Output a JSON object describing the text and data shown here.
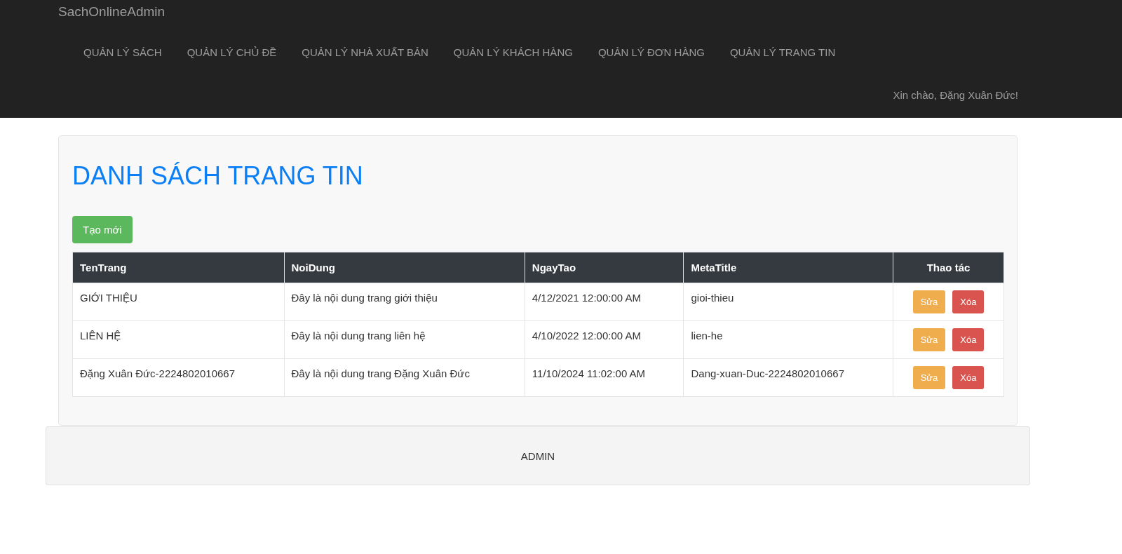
{
  "navbar": {
    "brand": "SachOnlineAdmin",
    "items": [
      "QUẢN LÝ SÁCH",
      "QUẢN LÝ CHỦ ĐỀ",
      "QUẢN LÝ NHÀ XUẤT BẢN",
      "QUẢN LÝ KHÁCH HÀNG",
      "QUẢN LÝ ĐƠN HÀNG",
      "QUẢN LÝ TRANG TIN"
    ],
    "greeting": "Xin chào, Đặng Xuân Đức!"
  },
  "page": {
    "title": "DANH SÁCH TRANG TIN",
    "create_button": "Tạo mới"
  },
  "table": {
    "columns": [
      "TenTrang",
      "NoiDung",
      "NgayTao",
      "MetaTitle",
      "Thao tác"
    ],
    "rows": [
      {
        "cells": [
          "GIỚI THIỆU",
          "Đây là nội dung trang giới thiệu",
          "4/12/2021 12:00:00 AM",
          "gioi-thieu"
        ],
        "actions": [
          "Sửa",
          "Xóa"
        ]
      },
      {
        "cells": [
          "LIÊN HỆ",
          "Đây là nội dung trang liên hệ",
          "4/10/2022 12:00:00 AM",
          "lien-he"
        ],
        "actions": [
          "Sửa",
          "Xóa"
        ]
      },
      {
        "cells": [
          "Đặng Xuân Đức-2224802010667",
          "Đây là nội dung trang Đặng Xuân Đức",
          "11/10/2024 11:02:00 AM",
          "Dang-xuan-Duc-2224802010667"
        ],
        "actions": [
          "Sửa",
          "Xóa"
        ]
      }
    ]
  },
  "footer": {
    "text": "ADMIN"
  }
}
